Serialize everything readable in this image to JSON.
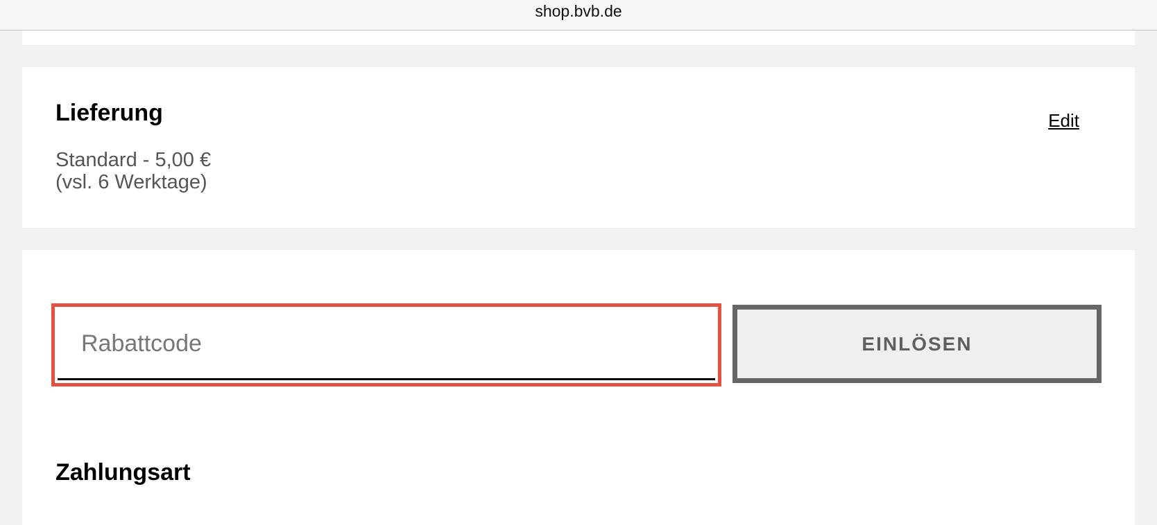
{
  "browser": {
    "url": "shop.bvb.de"
  },
  "delivery": {
    "title": "Lieferung",
    "edit_label": "Edit",
    "method": "Standard - 5,00 €",
    "duration": "(vsl. 6 Werktage)"
  },
  "coupon": {
    "placeholder": "Rabattcode",
    "value": "",
    "redeem_label": "EINLÖSEN",
    "highlight_color": "#e5503f"
  },
  "payment": {
    "title": "Zahlungsart"
  }
}
